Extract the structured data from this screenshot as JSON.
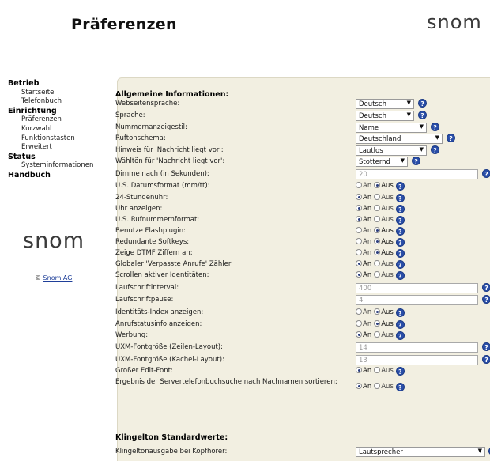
{
  "header": {
    "title": "Präferenzen",
    "brand": "snom"
  },
  "sidebar": {
    "sections": [
      {
        "label": "Betrieb",
        "items": [
          "Startseite",
          "Telefonbuch"
        ]
      },
      {
        "label": "Einrichtung",
        "items": [
          "Präferenzen",
          "Kurzwahl",
          "Funktionstasten",
          "Erweitert"
        ]
      },
      {
        "label": "Status",
        "items": [
          "Systeminformationen"
        ]
      },
      {
        "label": "Handbuch",
        "items": []
      }
    ],
    "brand": "snom",
    "copyright_symbol": "©",
    "copyright_link": "Snom AG"
  },
  "main": {
    "section1_title": "Allgemeine Informationen:",
    "section2_title": "Klingelton Standardwerte:",
    "radio_on": "An",
    "radio_off": "Aus",
    "help_glyph": "?",
    "rows": [
      {
        "label": "Webseitensprache:",
        "type": "select",
        "value": "Deutsch"
      },
      {
        "label": "Sprache:",
        "type": "select",
        "value": "Deutsch"
      },
      {
        "label": "Nummernanzeigestil:",
        "type": "select",
        "value": "Name"
      },
      {
        "label": "Rufton­schema:",
        "type": "select",
        "value": "Deutschland"
      },
      {
        "label": "Hinweis für 'Nachricht liegt vor':",
        "type": "select",
        "value": "Lautlos"
      },
      {
        "label": "Wähltön für 'Nachricht liegt vor':",
        "type": "select",
        "value": "Stotternd"
      },
      {
        "label": "Dimme nach (in Sekunden):",
        "type": "input",
        "value": "20"
      },
      {
        "label": "U.S. Datumsformat (mm/tt):",
        "type": "radio",
        "value": "Aus"
      },
      {
        "label": "24-Stundenuhr:",
        "type": "radio",
        "value": "An"
      },
      {
        "label": "Uhr anzeigen:",
        "type": "radio",
        "value": "An"
      },
      {
        "label": "U.S. Rufnummernformat:",
        "type": "radio",
        "value": "An"
      },
      {
        "label": "Benutze Flashplugin:",
        "type": "radio",
        "value": "Aus"
      },
      {
        "label": "Redundante Softkeys:",
        "type": "radio",
        "value": "Aus"
      },
      {
        "label": "Zeige DTMF Ziffern an:",
        "type": "radio",
        "value": "Aus"
      },
      {
        "label": "Globaler 'Verpasste Anrufe' Zähler:",
        "type": "radio",
        "value": "An"
      },
      {
        "label": "Scrollen aktiver Identitäten:",
        "type": "radio",
        "value": "An"
      },
      {
        "label": "Laufschriftinterval:",
        "type": "input",
        "value": "400"
      },
      {
        "label": "Laufschriftpause:",
        "type": "input",
        "value": "4"
      },
      {
        "label": "Identitäts-Index anzeigen:",
        "type": "radio",
        "value": "Aus"
      },
      {
        "label": "Anrufstatusinfo anzeigen:",
        "type": "radio",
        "value": "Aus"
      },
      {
        "label": "Werbung:",
        "type": "radio",
        "value": "An"
      },
      {
        "label": "UXM-Fontgröße (Zeilen-Layout):",
        "type": "input",
        "value": "14"
      },
      {
        "label": "UXM-Fontgröße (Kachel-Layout):",
        "type": "input",
        "value": "13"
      },
      {
        "label": "Großer Edit-Font:",
        "type": "radio",
        "value": "An"
      },
      {
        "label": "Ergebnis der Servertelefonbuchsuche nach Nachnamen sortieren:",
        "type": "radio",
        "value": "An"
      }
    ],
    "ring_rows": [
      {
        "label": "Klingeltonausgabe bei Kopfhörer:",
        "type": "select",
        "value": "Lautsprecher"
      }
    ]
  }
}
